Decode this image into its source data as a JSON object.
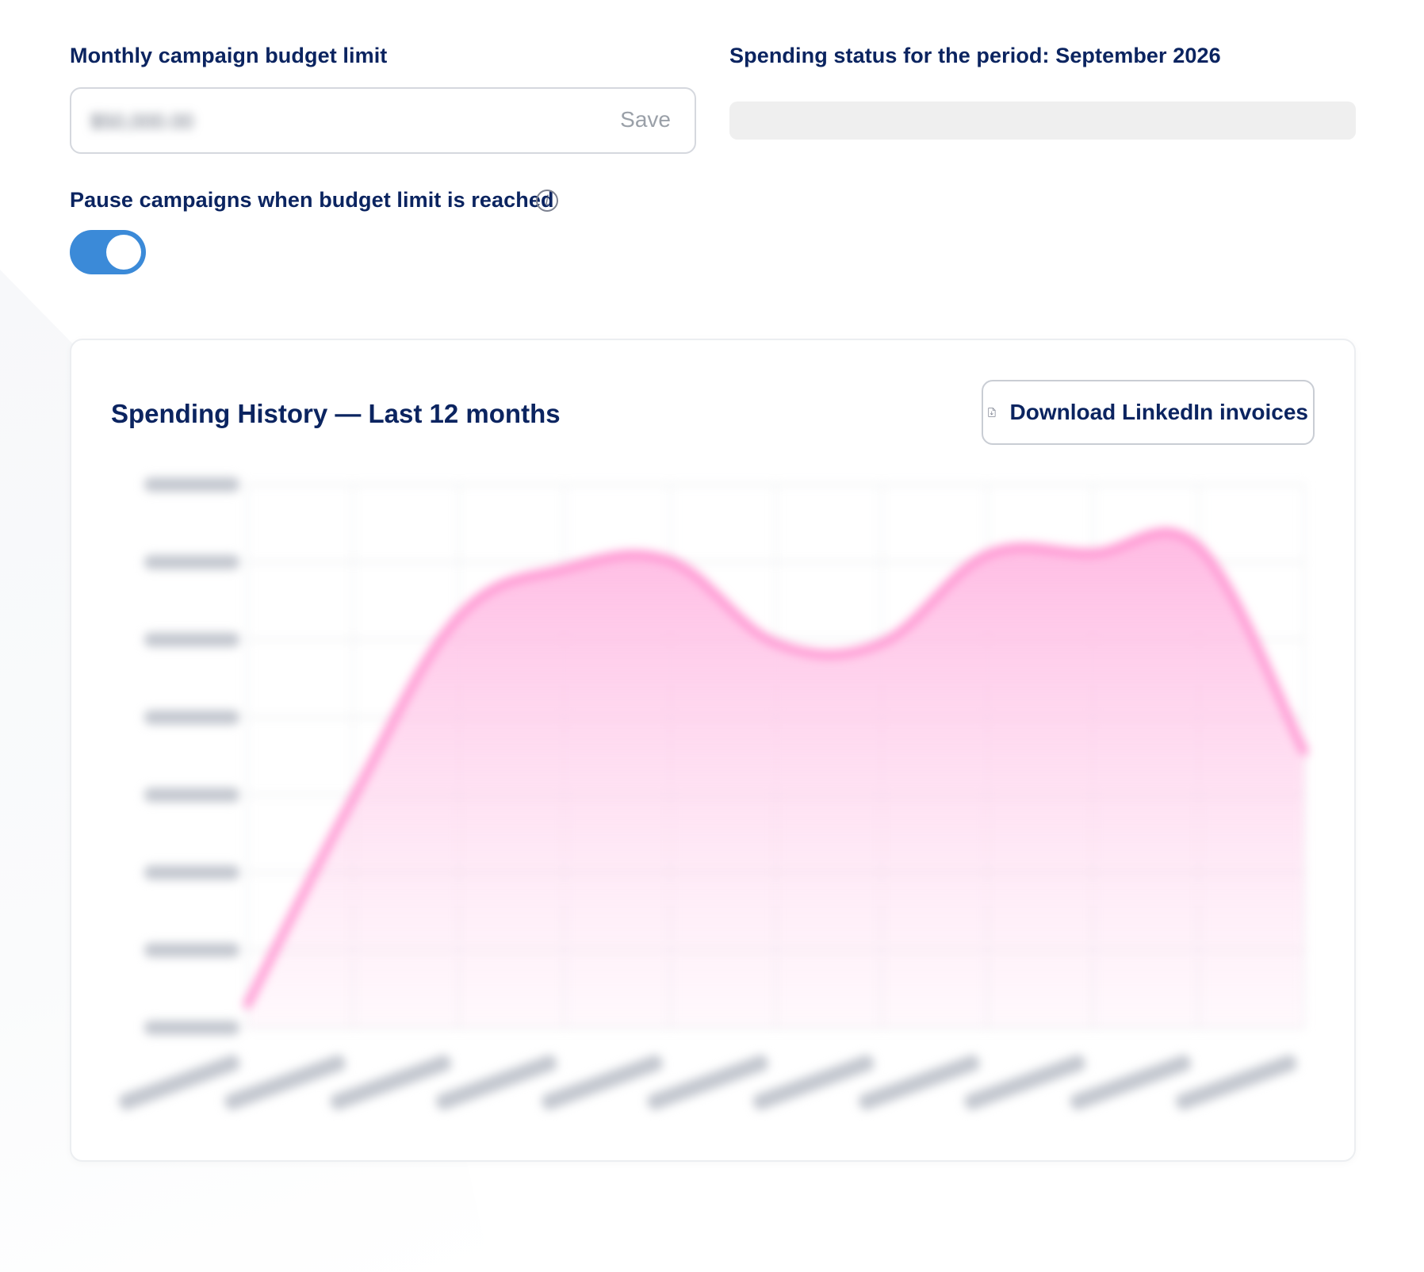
{
  "budget": {
    "label": "Monthly campaign budget limit",
    "value": "$50,000.00",
    "save_label": "Save"
  },
  "spending_status": {
    "label": "Spending status for the period: September 2026",
    "progress": 0
  },
  "pause": {
    "label": "Pause campaigns when budget limit is reached",
    "info_icon": "info-icon",
    "enabled": true
  },
  "history": {
    "title": "Spending History — Last 12 months",
    "download_label": "Download LinkedIn invoices",
    "download_icon": "file-download-icon"
  },
  "colors": {
    "accent": "#3b8ad8",
    "series_line": "#ff8fcf",
    "series_fill": "#ffb3e0",
    "title": "#0b2460"
  },
  "chart_data": {
    "type": "area",
    "categories": [
      "",
      "",
      "",
      "",
      "",
      "",
      "",
      "",
      "",
      "",
      ""
    ],
    "values": [
      15000,
      148000,
      265000,
      296000,
      301000,
      248000,
      248000,
      305000,
      306000,
      310000,
      178000
    ],
    "yticks": [
      0,
      50000,
      100000,
      150000,
      200000,
      250000,
      300000,
      350000
    ],
    "ytick_labels": [
      "",
      "",
      "",
      "",
      "",
      "",
      "",
      ""
    ],
    "ylim": [
      0,
      350000
    ],
    "grid": true
  }
}
